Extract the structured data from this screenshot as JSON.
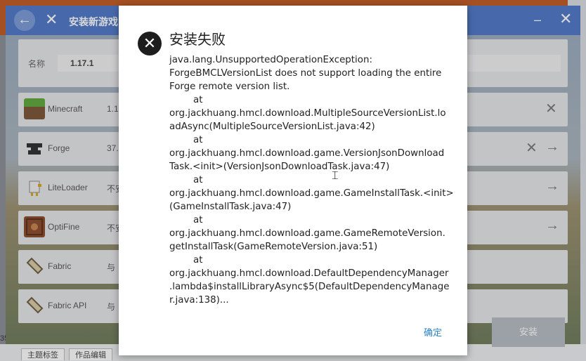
{
  "window": {
    "title": "安装新游戏",
    "back_icon": "arrow-left-icon",
    "close_icon": "close-icon",
    "minimize_symbol": "–",
    "close_symbol": "✕"
  },
  "name_field": {
    "label": "名称",
    "value": "1.17.1"
  },
  "components": [
    {
      "name": "Minecraft",
      "version": "1.1",
      "icon": "grass-block-icon",
      "color": "#5a8a3a"
    },
    {
      "name": "Forge",
      "version": "37.",
      "icon": "anvil-icon",
      "color": "#2e2e2e"
    },
    {
      "name": "LiteLoader",
      "version": "不安",
      "icon": "chicken-icon",
      "color": "#d7d7d7"
    },
    {
      "name": "OptiFine",
      "version": "不安",
      "icon": "optifine-icon",
      "color": "#8b4a2b"
    },
    {
      "name": "Fabric",
      "version": "与",
      "icon": "fabric-scroll-icon",
      "color": "#cfc3a6"
    },
    {
      "name": "Fabric API",
      "version": "与",
      "icon": "fabric-scroll-icon",
      "color": "#cfc3a6"
    }
  ],
  "install_button": "安装",
  "dialog": {
    "title": "安装失败",
    "message": "java.lang.UnsupportedOperationException:\nForgeBMCLVersionList does not support loading the entire\nForge remote version list.\n        at\norg.jackhuang.hmcl.download.MultipleSourceVersionList.lo\nadAsync(MultipleSourceVersionList.java:42)\n        at\norg.jackhuang.hmcl.download.game.VersionJsonDownload\nTask.<init>(VersionJsonDownloadTask.java:47)\n        at\norg.jackhuang.hmcl.download.game.GameInstallTask.<init>\n(GameInstallTask.java:47)\n        at\norg.jackhuang.hmcl.download.game.GameRemoteVersion.\ngetInstallTask(GameRemoteVersion.java:51)\n        at\norg.jackhuang.hmcl.download.DefaultDependencyManager\n.lambda$installLibraryAsync$5(DefaultDependencyManage\nr.java:138)...",
    "ok_label": "确定"
  },
  "background": {
    "left_edge_text": "35",
    "tab_1": "主题标签",
    "tab_2": "作品编辑"
  }
}
